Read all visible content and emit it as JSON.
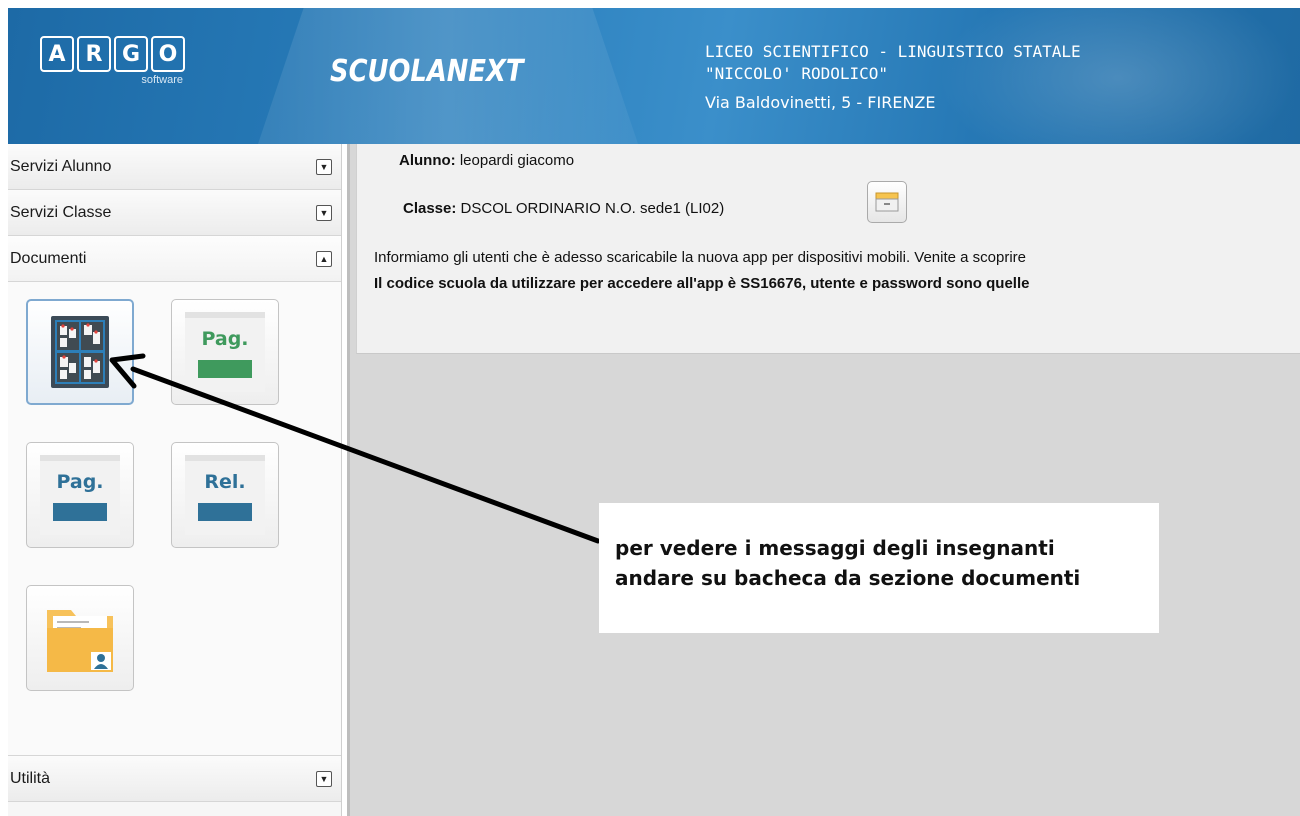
{
  "header": {
    "logo_letters": [
      "A",
      "R",
      "G",
      "O"
    ],
    "logo_sub": "software",
    "brand": "SCUOLANEXT",
    "school_line1": "LICEO SCIENTIFICO - LINGUISTICO STATALE",
    "school_line2": "\"NICCOLO' RODOLICO\"",
    "address": "Via Baldovinetti, 5 - FIRENZE"
  },
  "sidebar": {
    "sections": [
      {
        "label": "Servizi Alunno",
        "state": "collapsed"
      },
      {
        "label": "Servizi Classe",
        "state": "collapsed"
      },
      {
        "label": "Documenti",
        "state": "expanded"
      },
      {
        "label": "Utilità",
        "state": "collapsed"
      }
    ],
    "documenti_tiles": [
      {
        "icon": "bacheca-board-icon",
        "active": true
      },
      {
        "icon": "pagella-green-icon",
        "text": "Pag.",
        "color": "#3f9a5d"
      },
      {
        "icon": "pagella-blue-icon",
        "text": "Pag.",
        "color": "#2f7198"
      },
      {
        "icon": "relazione-blue-icon",
        "text": "Rel.",
        "color": "#2f7198"
      },
      {
        "icon": "folder-user-icon"
      }
    ]
  },
  "content": {
    "student_label": "Alunno:",
    "student_value": "leopardi giacomo",
    "class_label": "Classe:",
    "class_value": "DSCOL ORDINARIO N.O. sede1 (LI02)",
    "class_button_icon": "drawer-icon",
    "notice_line1": "Informiamo gli utenti che è adesso scaricabile la nuova app per dispositivi mobili. Venite a scoprire",
    "notice_line2": "Il codice scuola da utilizzare per accedere all'app è SS16676, utente e password sono quelle"
  },
  "annotation": {
    "line1": "per vedere i messaggi degli insegnanti",
    "line2": "andare su bacheca da sezione documenti"
  },
  "colors": {
    "header_blue": "#2a7fbd",
    "pag_green": "#3f9a5d",
    "pag_blue": "#2f7198",
    "folder_yellow": "#f7c25b"
  }
}
